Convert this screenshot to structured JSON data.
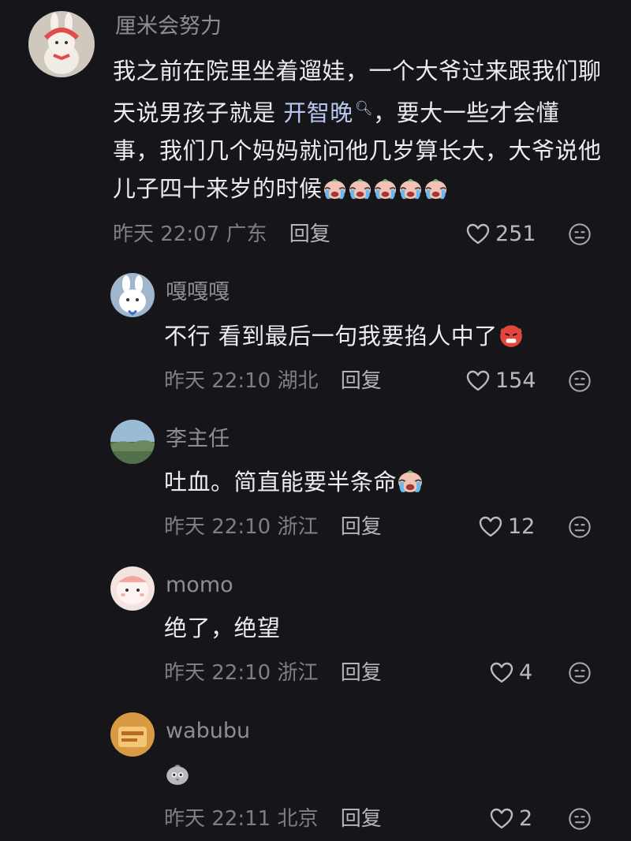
{
  "comments": [
    {
      "username": "厘米会努力",
      "text_before": "我之前在院里坐着遛娃，一个大爷过来跟我们聊天说男孩子就是 ",
      "link_text": "开智晚",
      "text_after": "，要大一些才会懂事，我们几个妈妈就问他几岁算长大，大爷说他儿子四十来岁的时候",
      "emoji": "crying-face-emoji ×5",
      "time": "昨天 22:07",
      "location": "广东",
      "reply_label": "回复",
      "likes": "251"
    },
    {
      "username": "嘎嘎嘎",
      "text": "不行 看到最后一句我要掐人中了",
      "emoji": "angry-devil-emoji",
      "time": "昨天 22:10",
      "location": "湖北",
      "reply_label": "回复",
      "likes": "154"
    },
    {
      "username": "李主任",
      "text": "吐血。简直能要半条命",
      "emoji": "crying-face-emoji",
      "time": "昨天 22:10",
      "location": "浙江",
      "reply_label": "回复",
      "likes": "12"
    },
    {
      "username": "momo",
      "text": "绝了，绝望",
      "time": "昨天 22:10",
      "location": "浙江",
      "reply_label": "回复",
      "likes": "4"
    },
    {
      "username": "wabubu",
      "text": "",
      "emoji": "pigeon-emoji",
      "time": "昨天 22:11",
      "location": "北京",
      "reply_label": "回复",
      "likes": "2"
    }
  ],
  "colors": {
    "background": "#16161a",
    "text": "#ececef",
    "secondary": "#7e7e86",
    "link": "#b9c6f0"
  },
  "icons": {
    "like": "heart-outline-icon",
    "dislike": "meh-face-icon"
  }
}
